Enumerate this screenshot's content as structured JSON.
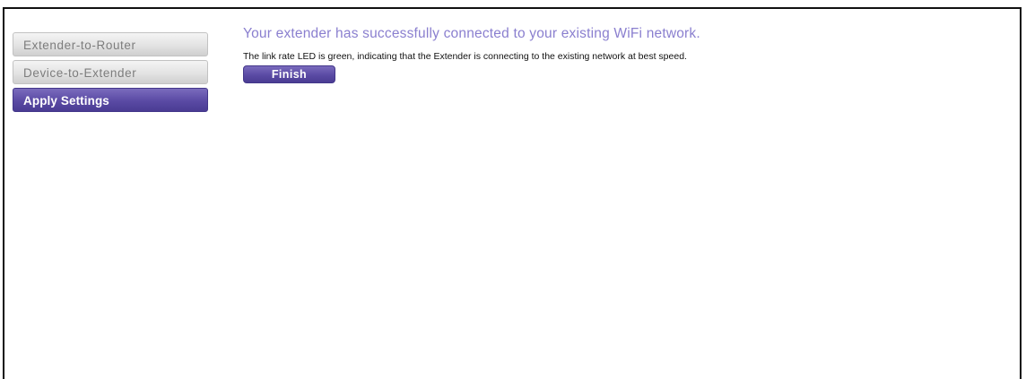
{
  "sidebar": {
    "items": [
      {
        "label": "Extender-to-Router",
        "state": "inactive"
      },
      {
        "label": "Device-to-Extender",
        "state": "inactive"
      },
      {
        "label": "Apply Settings",
        "state": "active"
      }
    ]
  },
  "main": {
    "headline": "Your extender has successfully connected to your existing WiFi network.",
    "description": "The link rate LED is green, indicating that the Extender is connecting to the existing network at best speed.",
    "finish_label": "Finish"
  },
  "colors": {
    "accent_purple": "#5a4aa4",
    "headline_text": "#8a7fcf",
    "inactive_text": "#7d7d7d"
  }
}
